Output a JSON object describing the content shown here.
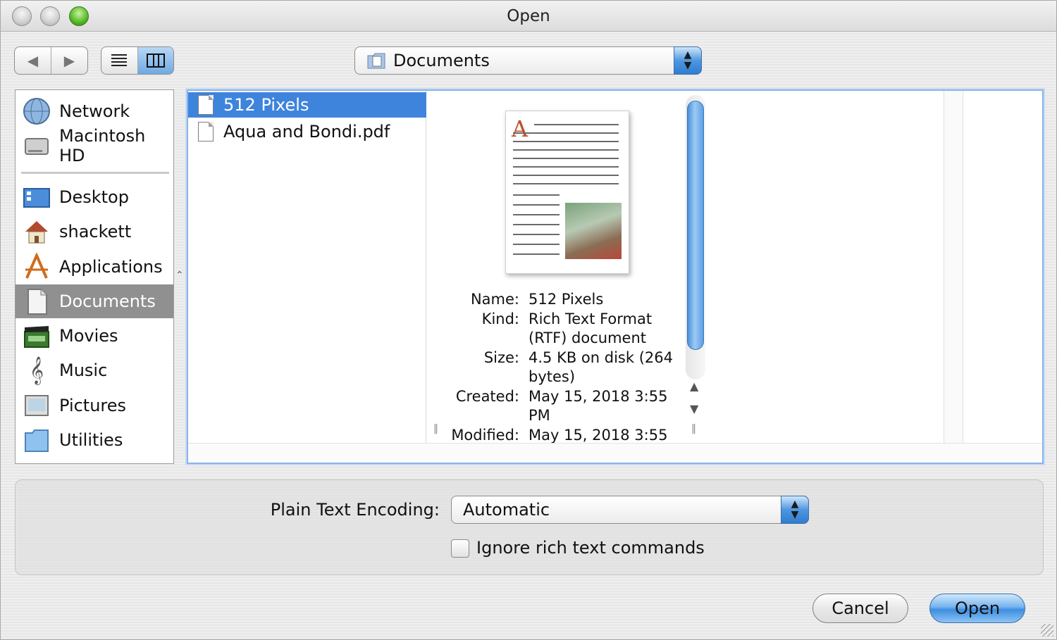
{
  "window": {
    "title": "Open"
  },
  "toolbar": {
    "location": "Documents"
  },
  "sidebar": {
    "devices": [
      {
        "label": "Network",
        "icon": "network-globe-icon"
      },
      {
        "label": "Macintosh HD",
        "icon": "hard-drive-icon"
      }
    ],
    "places": [
      {
        "label": "Desktop",
        "icon": "desktop-folder-icon"
      },
      {
        "label": "shackett",
        "icon": "home-icon"
      },
      {
        "label": "Applications",
        "icon": "applications-icon"
      },
      {
        "label": "Documents",
        "icon": "documents-icon",
        "selected": true
      },
      {
        "label": "Movies",
        "icon": "movies-icon"
      },
      {
        "label": "Music",
        "icon": "music-icon"
      },
      {
        "label": "Pictures",
        "icon": "pictures-icon"
      },
      {
        "label": "Utilities",
        "icon": "utilities-folder-icon"
      }
    ]
  },
  "files": [
    {
      "name": "512 Pixels",
      "selected": true
    },
    {
      "name": "Aqua and Bondi.pdf",
      "selected": false
    }
  ],
  "info": {
    "name_label": "Name:",
    "name_value": "512 Pixels",
    "kind_label": "Kind:",
    "kind_value_1": "Rich Text Format",
    "kind_value_2": "(RTF) document",
    "size_label": "Size:",
    "size_value_1": "4.5 KB on disk (264",
    "size_value_2": "bytes)",
    "created_label": "Created:",
    "created_value_1": "May 15, 2018 3:55",
    "created_value_2": "PM",
    "modified_label": "Modified:",
    "modified_value_1": "May 15, 2018 3:55"
  },
  "options": {
    "encoding_label": "Plain Text Encoding:",
    "encoding_value": "Automatic",
    "ignore_rich_text_label": "Ignore rich text commands",
    "ignore_rich_text_checked": false
  },
  "buttons": {
    "cancel": "Cancel",
    "open": "Open"
  },
  "colors": {
    "selection": "#3e84dd",
    "sidebar_selection": "#909090",
    "accent": "#4e97e0"
  }
}
